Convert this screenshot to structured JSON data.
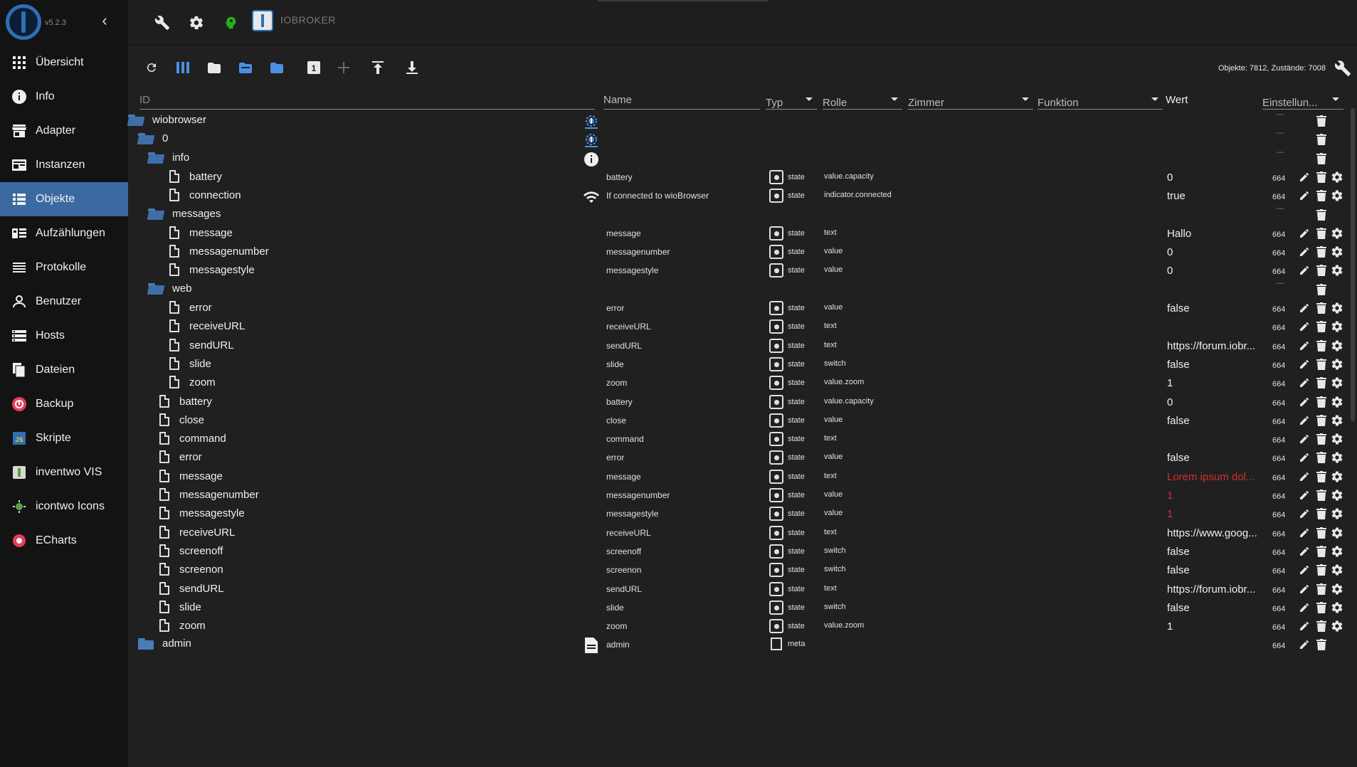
{
  "app": {
    "version": "v5.2.3",
    "title": "IOBROKER"
  },
  "sidebar": {
    "items": [
      {
        "label": "Übersicht",
        "icon": "grid-icon"
      },
      {
        "label": "Info",
        "icon": "info-icon"
      },
      {
        "label": "Adapter",
        "icon": "store-icon"
      },
      {
        "label": "Instanzen",
        "icon": "instances-icon"
      },
      {
        "label": "Objekte",
        "icon": "list-icon",
        "active": true
      },
      {
        "label": "Aufzählungen",
        "icon": "enum-icon"
      },
      {
        "label": "Protokolle",
        "icon": "log-icon"
      },
      {
        "label": "Benutzer",
        "icon": "user-icon"
      },
      {
        "label": "Hosts",
        "icon": "hosts-icon"
      },
      {
        "label": "Dateien",
        "icon": "files-icon"
      },
      {
        "label": "Backup",
        "icon": "backup-icon"
      },
      {
        "label": "Skripte",
        "icon": "js-icon"
      },
      {
        "label": "inventwo VIS",
        "icon": "inventwo-icon"
      },
      {
        "label": "icontwo Icons",
        "icon": "icontwo-icon"
      },
      {
        "label": "ECharts",
        "icon": "echarts-icon"
      }
    ]
  },
  "toolbar": {
    "counts": "Objekte: 7812, Zustände: 7008"
  },
  "columns": {
    "id": "ID",
    "name": "Name",
    "typ": "Typ",
    "rolle": "Rolle",
    "zimmer": "Zimmer",
    "funktion": "Funktion",
    "wert": "Wert",
    "einstellungen": "Einstellun..."
  },
  "rows": [
    {
      "id": "wiobrowser",
      "level": 0,
      "kind": "folder-open",
      "nicon": "wiobrowser-logo-icon",
      "name": "",
      "typ": "",
      "rolle": "",
      "wert": "",
      "acl": "",
      "dash": "---"
    },
    {
      "id": "0",
      "level": 1,
      "kind": "folder-open",
      "nicon": "wiobrowser-logo-icon",
      "name": "",
      "typ": "",
      "rolle": "",
      "wert": "",
      "acl": "",
      "dash": "---"
    },
    {
      "id": "info",
      "level": 2,
      "kind": "folder-open",
      "nicon": "info-circle-icon",
      "name": "",
      "typ": "",
      "rolle": "",
      "wert": "",
      "acl": "",
      "dash": "---"
    },
    {
      "id": "battery",
      "level": 3,
      "kind": "file",
      "nicon": "",
      "name": "battery",
      "typ": "state",
      "rolle": "value.capacity",
      "wert": "0",
      "acl": "664",
      "dash": ""
    },
    {
      "id": "connection",
      "level": 3,
      "kind": "file",
      "nicon": "wifi-icon",
      "name": "If connected to wioBrowser",
      "typ": "state",
      "rolle": "indicator.connected",
      "wert": "true",
      "acl": "664",
      "dash": ""
    },
    {
      "id": "messages",
      "level": 2,
      "kind": "folder-open",
      "nicon": "",
      "name": "",
      "typ": "",
      "rolle": "",
      "wert": "",
      "acl": "",
      "dash": "---"
    },
    {
      "id": "message",
      "level": 3,
      "kind": "file",
      "nicon": "",
      "name": "message",
      "typ": "state",
      "rolle": "text",
      "wert": "Hallo",
      "acl": "664",
      "dash": ""
    },
    {
      "id": "messagenumber",
      "level": 3,
      "kind": "file",
      "nicon": "",
      "name": "messagenumber",
      "typ": "state",
      "rolle": "value",
      "wert": "0",
      "acl": "664",
      "dash": ""
    },
    {
      "id": "messagestyle",
      "level": 3,
      "kind": "file",
      "nicon": "",
      "name": "messagestyle",
      "typ": "state",
      "rolle": "value",
      "wert": "0",
      "acl": "664",
      "dash": ""
    },
    {
      "id": "web",
      "level": 2,
      "kind": "folder-open",
      "nicon": "",
      "name": "",
      "typ": "",
      "rolle": "",
      "wert": "",
      "acl": "",
      "dash": "---"
    },
    {
      "id": "error",
      "level": 3,
      "kind": "file",
      "nicon": "",
      "name": "error",
      "typ": "state",
      "rolle": "value",
      "wert": "false",
      "acl": "664",
      "dash": ""
    },
    {
      "id": "receiveURL",
      "level": 3,
      "kind": "file",
      "nicon": "",
      "name": "receiveURL",
      "typ": "state",
      "rolle": "text",
      "wert": "",
      "acl": "664",
      "dash": ""
    },
    {
      "id": "sendURL",
      "level": 3,
      "kind": "file",
      "nicon": "",
      "name": "sendURL",
      "typ": "state",
      "rolle": "text",
      "wert": "https://forum.iobr...",
      "acl": "664",
      "dash": ""
    },
    {
      "id": "slide",
      "level": 3,
      "kind": "file",
      "nicon": "",
      "name": "slide",
      "typ": "state",
      "rolle": "switch",
      "wert": "false",
      "acl": "664",
      "dash": ""
    },
    {
      "id": "zoom",
      "level": 3,
      "kind": "file",
      "nicon": "",
      "name": "zoom",
      "typ": "state",
      "rolle": "value.zoom",
      "wert": "1",
      "acl": "664",
      "dash": ""
    },
    {
      "id": "battery",
      "level": 2,
      "kind": "file",
      "nicon": "",
      "name": "battery",
      "typ": "state",
      "rolle": "value.capacity",
      "wert": "0",
      "acl": "664",
      "dash": ""
    },
    {
      "id": "close",
      "level": 2,
      "kind": "file",
      "nicon": "",
      "name": "close",
      "typ": "state",
      "rolle": "value",
      "wert": "false",
      "acl": "664",
      "dash": ""
    },
    {
      "id": "command",
      "level": 2,
      "kind": "file",
      "nicon": "",
      "name": "command",
      "typ": "state",
      "rolle": "text",
      "wert": "",
      "acl": "664",
      "dash": ""
    },
    {
      "id": "error",
      "level": 2,
      "kind": "file",
      "nicon": "",
      "name": "error",
      "typ": "state",
      "rolle": "value",
      "wert": "false",
      "acl": "664",
      "dash": ""
    },
    {
      "id": "message",
      "level": 2,
      "kind": "file",
      "nicon": "",
      "name": "message",
      "typ": "state",
      "rolle": "text",
      "wert": "Lorem ipsum dol...",
      "red": true,
      "acl": "664",
      "dash": ""
    },
    {
      "id": "messagenumber",
      "level": 2,
      "kind": "file",
      "nicon": "",
      "name": "messagenumber",
      "typ": "state",
      "rolle": "value",
      "wert": "1",
      "red": true,
      "acl": "664",
      "dash": ""
    },
    {
      "id": "messagestyle",
      "level": 2,
      "kind": "file",
      "nicon": "",
      "name": "messagestyle",
      "typ": "state",
      "rolle": "value",
      "wert": "1",
      "red": true,
      "acl": "664",
      "dash": ""
    },
    {
      "id": "receiveURL",
      "level": 2,
      "kind": "file",
      "nicon": "",
      "name": "receiveURL",
      "typ": "state",
      "rolle": "text",
      "wert": "https://www.goog...",
      "acl": "664",
      "dash": ""
    },
    {
      "id": "screenoff",
      "level": 2,
      "kind": "file",
      "nicon": "",
      "name": "screenoff",
      "typ": "state",
      "rolle": "switch",
      "wert": "false",
      "acl": "664",
      "dash": ""
    },
    {
      "id": "screenon",
      "level": 2,
      "kind": "file",
      "nicon": "",
      "name": "screenon",
      "typ": "state",
      "rolle": "switch",
      "wert": "false",
      "acl": "664",
      "dash": ""
    },
    {
      "id": "sendURL",
      "level": 2,
      "kind": "file",
      "nicon": "",
      "name": "sendURL",
      "typ": "state",
      "rolle": "text",
      "wert": "https://forum.iobr...",
      "acl": "664",
      "dash": ""
    },
    {
      "id": "slide",
      "level": 2,
      "kind": "file",
      "nicon": "",
      "name": "slide",
      "typ": "state",
      "rolle": "switch",
      "wert": "false",
      "acl": "664",
      "dash": ""
    },
    {
      "id": "zoom",
      "level": 2,
      "kind": "file",
      "nicon": "",
      "name": "zoom",
      "typ": "state",
      "rolle": "value.zoom",
      "wert": "1",
      "acl": "664",
      "dash": ""
    },
    {
      "id": "admin",
      "level": 1,
      "kind": "folder-closed",
      "nicon": "document-icon",
      "name": "admin",
      "typ": "meta",
      "rolle": "",
      "wert": "",
      "acl": "664",
      "dash": ""
    }
  ],
  "colors": {
    "accent": "#3b6aa0",
    "folder": "#4a7bb7",
    "error_value": "#d32f2f",
    "background": "#202020",
    "sidebar": "#131313"
  }
}
